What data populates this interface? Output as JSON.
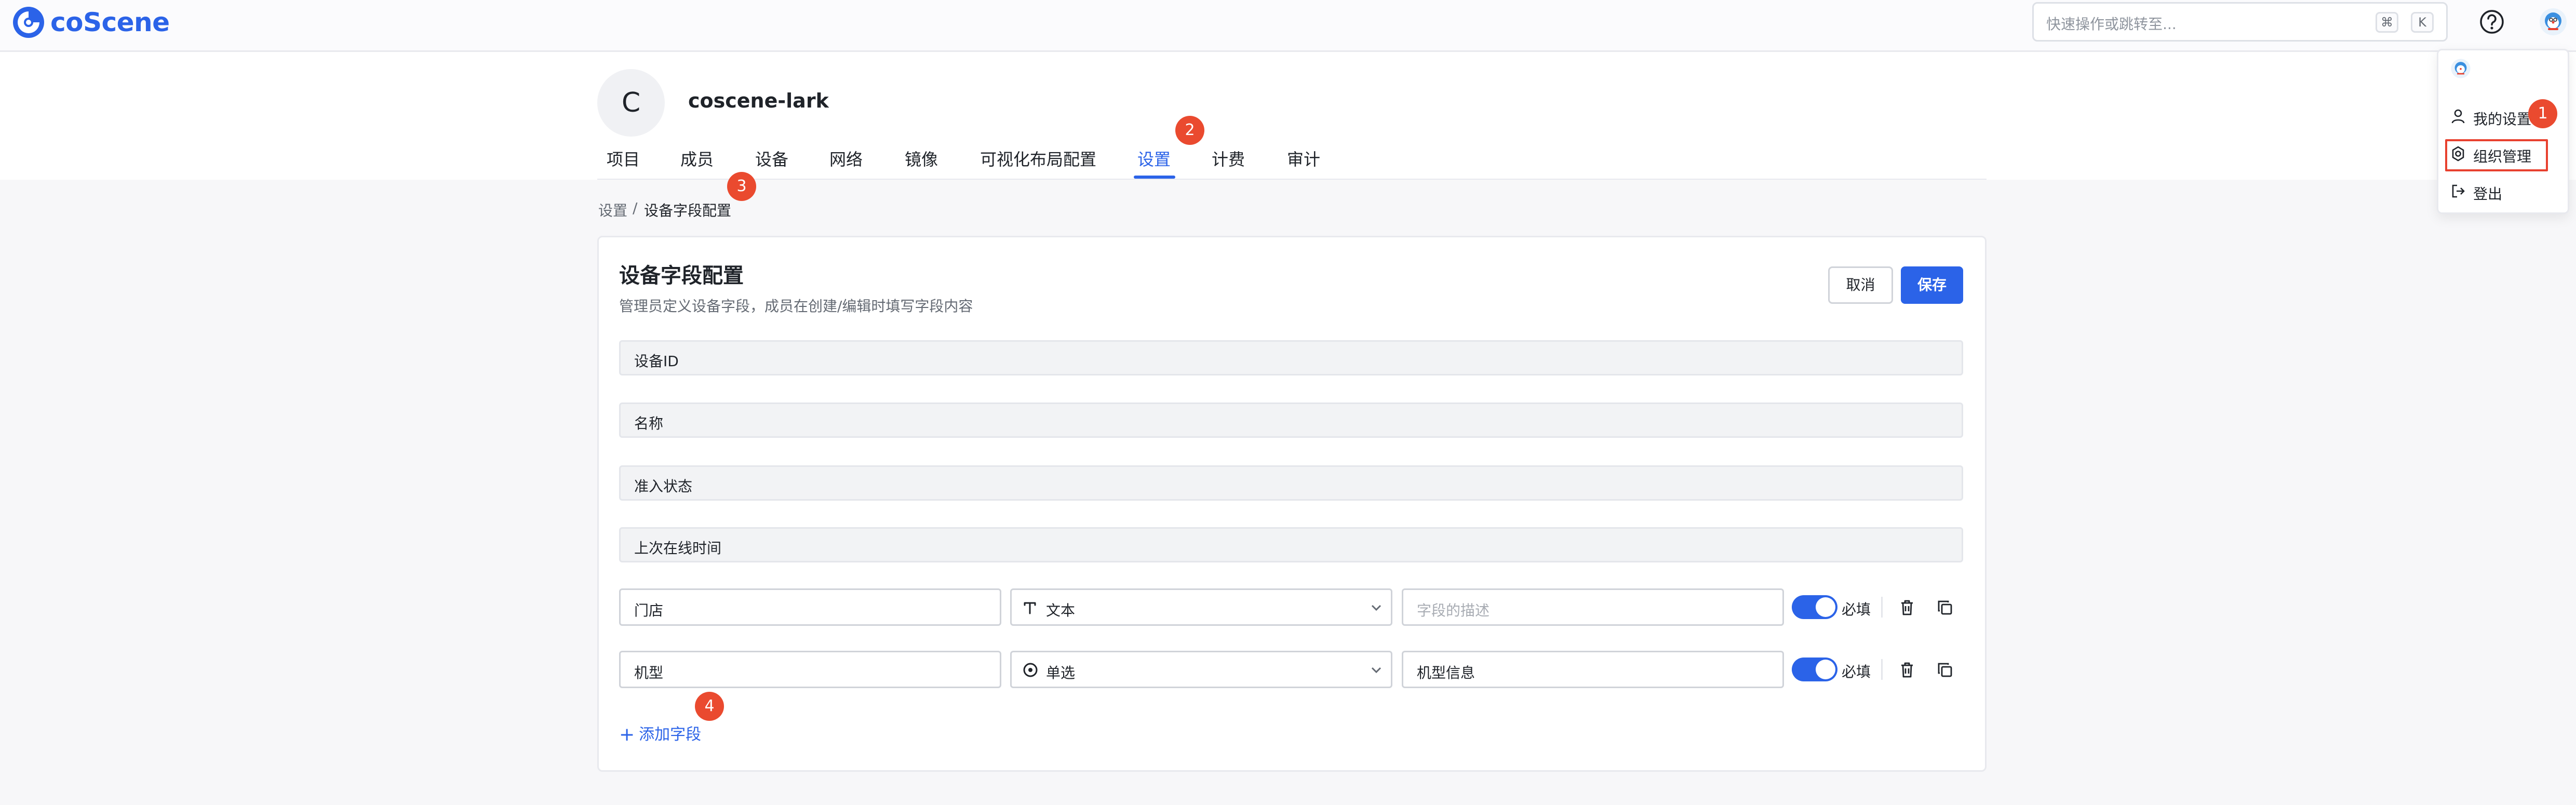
{
  "app": {
    "brand": "coScene",
    "brand_color": "#2b63e8"
  },
  "topbar": {
    "search_placeholder": "快速操作或跳转至...",
    "shortcut_keys": [
      "⌘",
      "K"
    ],
    "icons": [
      "help-circle-icon",
      "user-avatar-icon"
    ]
  },
  "org": {
    "avatar_letter": "C",
    "name": "coscene-lark"
  },
  "tabs": [
    {
      "label": "项目",
      "active": false
    },
    {
      "label": "成员",
      "active": false
    },
    {
      "label": "设备",
      "active": false
    },
    {
      "label": "网络",
      "active": false
    },
    {
      "label": "镜像",
      "active": false
    },
    {
      "label": "可视化布局配置",
      "active": false
    },
    {
      "label": "设置",
      "active": true
    },
    {
      "label": "计费",
      "active": false
    },
    {
      "label": "审计",
      "active": false
    }
  ],
  "breadcrumb": {
    "items": [
      "设置",
      "设备字段配置"
    ],
    "separator": "/"
  },
  "page": {
    "title": "设备字段配置",
    "description": "管理员定义设备字段，成员在创建/编辑时填写字段内容",
    "cancel_label": "取消",
    "save_label": "保存"
  },
  "fixed_fields": [
    "设备ID",
    "名称",
    "准入状态",
    "上次在线时间"
  ],
  "custom_fields": [
    {
      "name": "门店",
      "type_icon": "text-type-icon",
      "type_label": "文本",
      "description": "",
      "description_placeholder": "字段的描述",
      "required": true,
      "required_label": "必填"
    },
    {
      "name": "机型",
      "type_icon": "radio-type-icon",
      "type_label": "单选",
      "description": "机型信息",
      "description_placeholder": "字段的描述",
      "required": true,
      "required_label": "必填"
    }
  ],
  "add_field_label": "添加字段",
  "user_menu": {
    "items": [
      {
        "label": "我的设置",
        "icon": "user-icon"
      },
      {
        "label": "组织管理",
        "icon": "gear-icon"
      },
      {
        "label": "登出",
        "icon": "logout-icon"
      }
    ]
  },
  "annotations": {
    "badges": [
      "1",
      "2",
      "3",
      "4"
    ],
    "color": "#ea4a2f"
  }
}
